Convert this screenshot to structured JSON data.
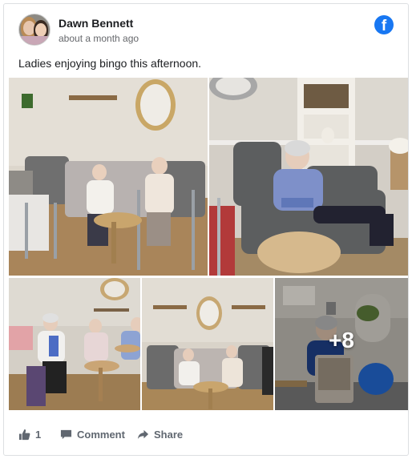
{
  "post": {
    "author_name": "Dawn Bennett",
    "timestamp": "about a month ago",
    "text": "Ladies enjoying bingo this afternoon.",
    "platform_icon": "facebook-icon",
    "brand_color": "#1877f2"
  },
  "gallery": {
    "photos": [
      {
        "name": "photo-1",
        "alt": "Residents playing bingo in lounge"
      },
      {
        "name": "photo-2",
        "alt": "Resident seated in grey armchair playing bingo"
      },
      {
        "name": "photo-3",
        "alt": "Residents seated around small tables"
      },
      {
        "name": "photo-4",
        "alt": "Residents at bingo in lounge"
      },
      {
        "name": "photo-5",
        "alt": "Resident at table in conservatory"
      }
    ],
    "more_count_label": "+8"
  },
  "actions": {
    "like_count": "1",
    "comment_label": "Comment",
    "share_label": "Share",
    "like_icon": "thumbs-up-icon",
    "comment_icon": "comment-icon",
    "share_icon": "share-arrow-icon"
  }
}
